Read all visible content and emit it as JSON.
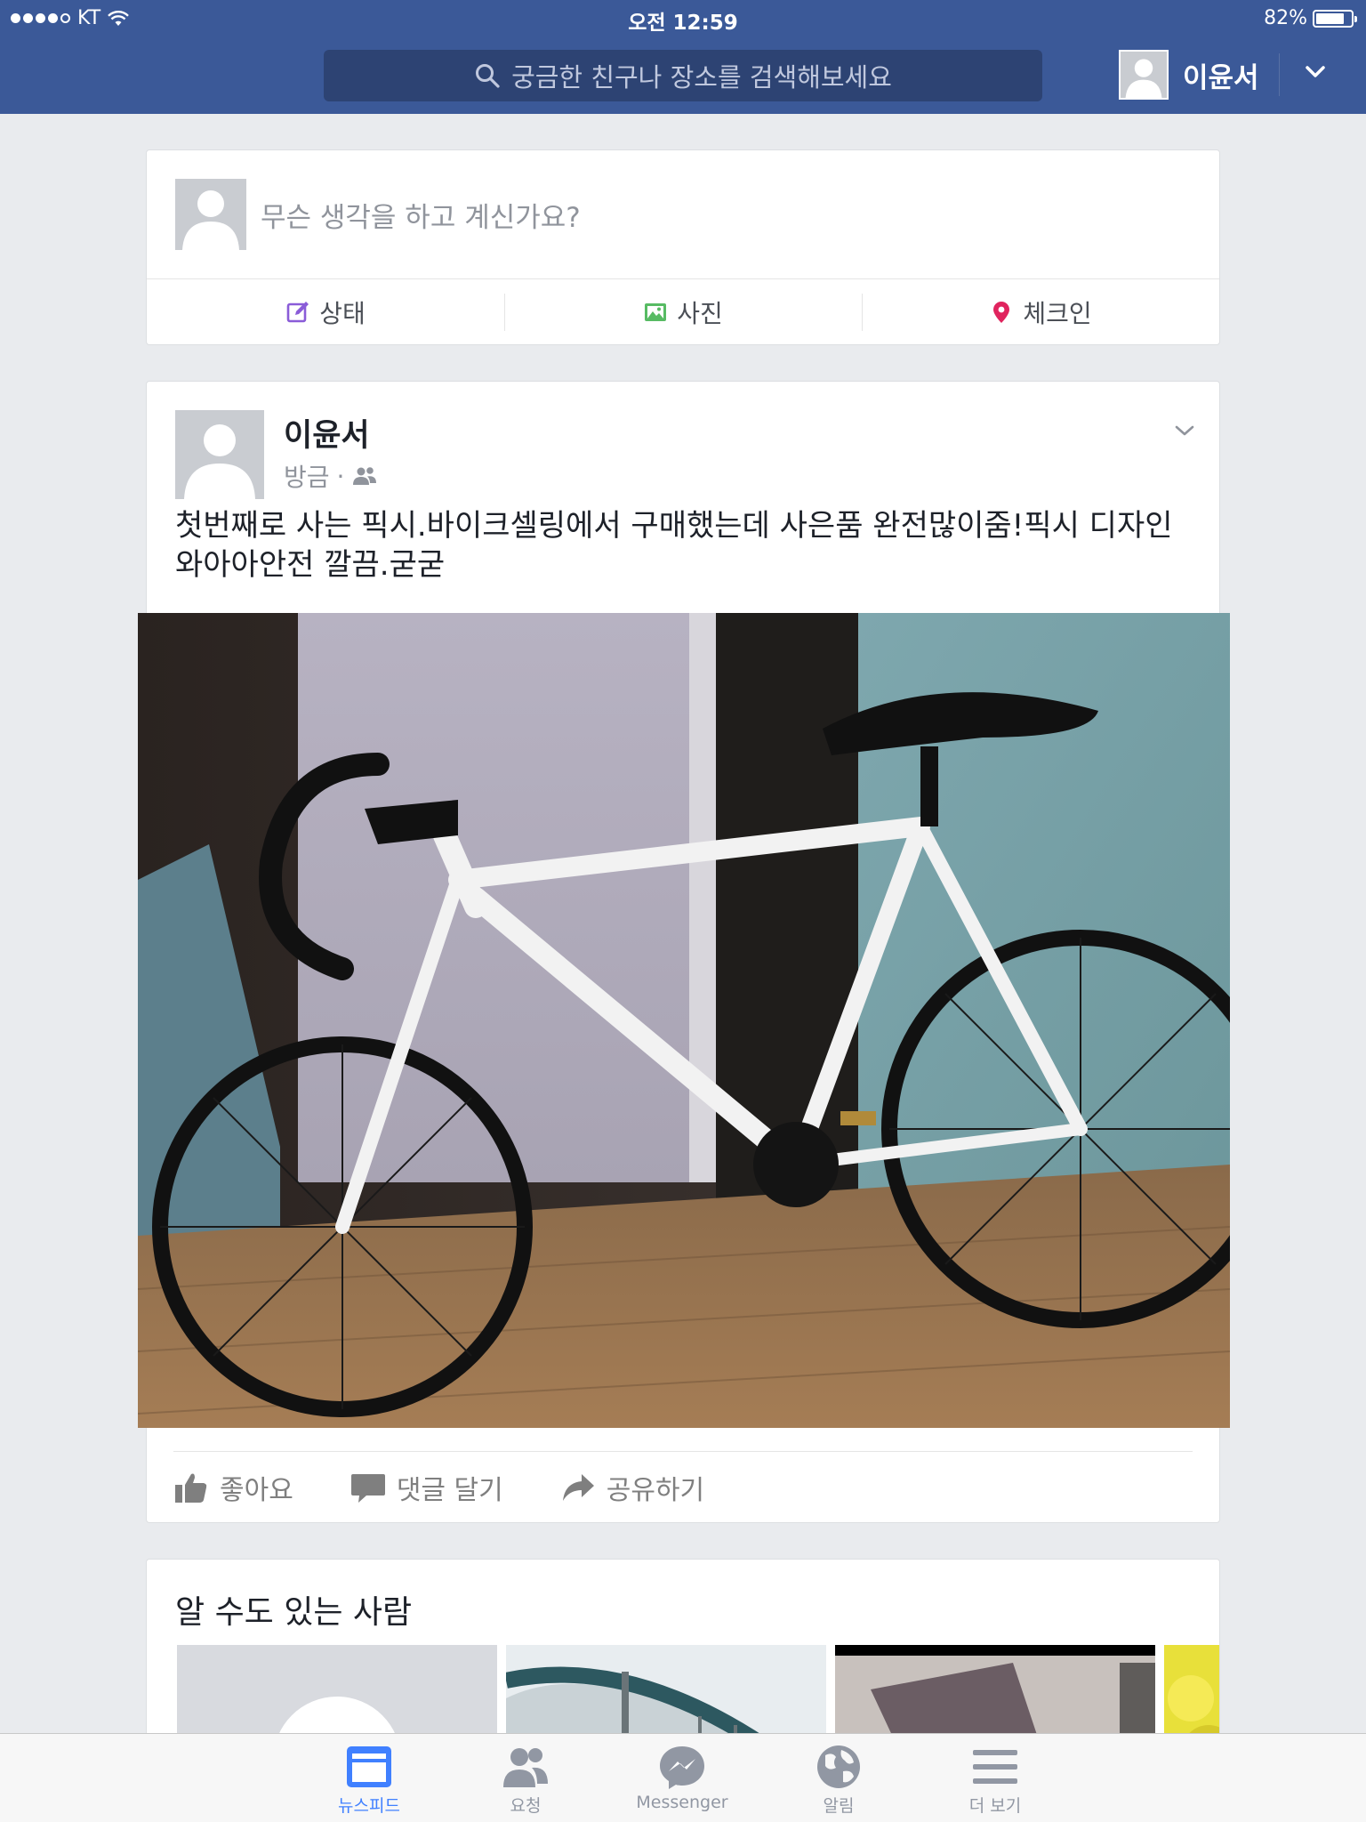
{
  "status_bar": {
    "carrier": "KT",
    "time": "오전 12:59",
    "battery_percent": "82%",
    "battery_level": 0.82
  },
  "header": {
    "search_placeholder": "궁금한 친구나 장소를 검색해보세요",
    "user_name": "이윤서"
  },
  "composer": {
    "placeholder": "무슨 생각을 하고 계신가요?",
    "actions": [
      {
        "label": "상태",
        "icon": "edit-icon"
      },
      {
        "label": "사진",
        "icon": "photo-icon"
      },
      {
        "label": "체크인",
        "icon": "location-pin-icon"
      }
    ]
  },
  "post": {
    "author": "이윤서",
    "time": "방금",
    "audience_icon": "friends-icon",
    "text": "첫번째로 사는 픽시.바이크셀링에서 구매했는데 사은품 완전많이줌!픽시 디자인 와아아안전 깔끔.굳굳",
    "actions": [
      {
        "label": "좋아요",
        "icon": "like-icon"
      },
      {
        "label": "댓글 달기",
        "icon": "comment-icon"
      },
      {
        "label": "공유하기",
        "icon": "share-icon"
      }
    ]
  },
  "pymk": {
    "title": "알 수도 있는 사람"
  },
  "tabs": [
    {
      "label": "뉴스피드",
      "icon": "newsfeed-icon",
      "active": true
    },
    {
      "label": "요청",
      "icon": "friend-requests-icon",
      "active": false
    },
    {
      "label": "Messenger",
      "icon": "messenger-icon",
      "active": false
    },
    {
      "label": "알림",
      "icon": "globe-icon",
      "active": false
    },
    {
      "label": "더 보기",
      "icon": "menu-icon",
      "active": false
    }
  ],
  "colors": {
    "brand": "#3b5998",
    "tab_active": "#4080ff",
    "checkin_pin": "#e0245e",
    "status_icon": "#8a5cd8",
    "photo_icon": "#57bb63"
  }
}
